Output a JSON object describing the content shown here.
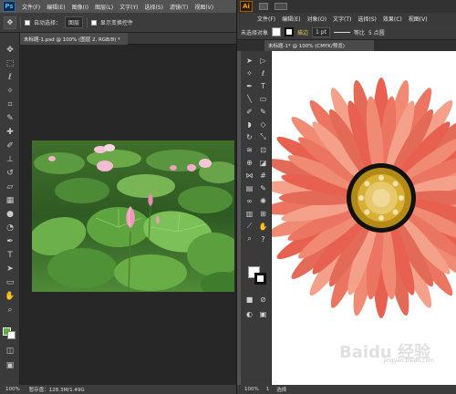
{
  "ps": {
    "logo": "Ps",
    "menu": [
      "文件(F)",
      "编辑(E)",
      "图像(I)",
      "图层(L)",
      "文字(Y)",
      "选择(S)",
      "滤镜(T)",
      "视图(V)"
    ],
    "options": {
      "auto_select_label": "自动选择：",
      "auto_select_value": "图层",
      "transform_label": "显示变换控件"
    },
    "tab_title": "未标题-1.psd @ 100% (图层 2, RGB/8) *",
    "status": {
      "zoom": "100%",
      "scratch": "暂存盘：128.3M/1.49G"
    },
    "colors": {
      "foreground": "#5db03d",
      "background": "#ffffff"
    }
  },
  "ai": {
    "logo": "Ai",
    "menu": [
      "文件(F)",
      "编辑(E)",
      "对象(O)",
      "文字(T)",
      "选择(S)",
      "效果(C)",
      "视图(V)"
    ],
    "controls": {
      "selection_label": "未选择对象",
      "stroke_label": "描边",
      "stroke_value": "1 pt",
      "profile_label": "等比",
      "brush_label": "5 点圆"
    },
    "tab_title": "未标题-1* @ 100% (CMYK/预览)",
    "status": {
      "zoom": "100%",
      "page": "1",
      "mode": "选择"
    }
  },
  "watermark": {
    "logo": "Baidu 经验",
    "url": "jingyan.baidu.com"
  },
  "icons": [
    "move-icon",
    "marquee-icon",
    "lasso-icon",
    "magic-wand-icon",
    "crop-icon",
    "eyedropper-icon",
    "brush-icon",
    "stamp-icon",
    "eraser-icon",
    "gradient-icon",
    "blur-icon",
    "dodge-icon",
    "pen-icon",
    "type-icon",
    "path-select-icon",
    "rectangle-icon",
    "hand-icon",
    "zoom-icon"
  ]
}
